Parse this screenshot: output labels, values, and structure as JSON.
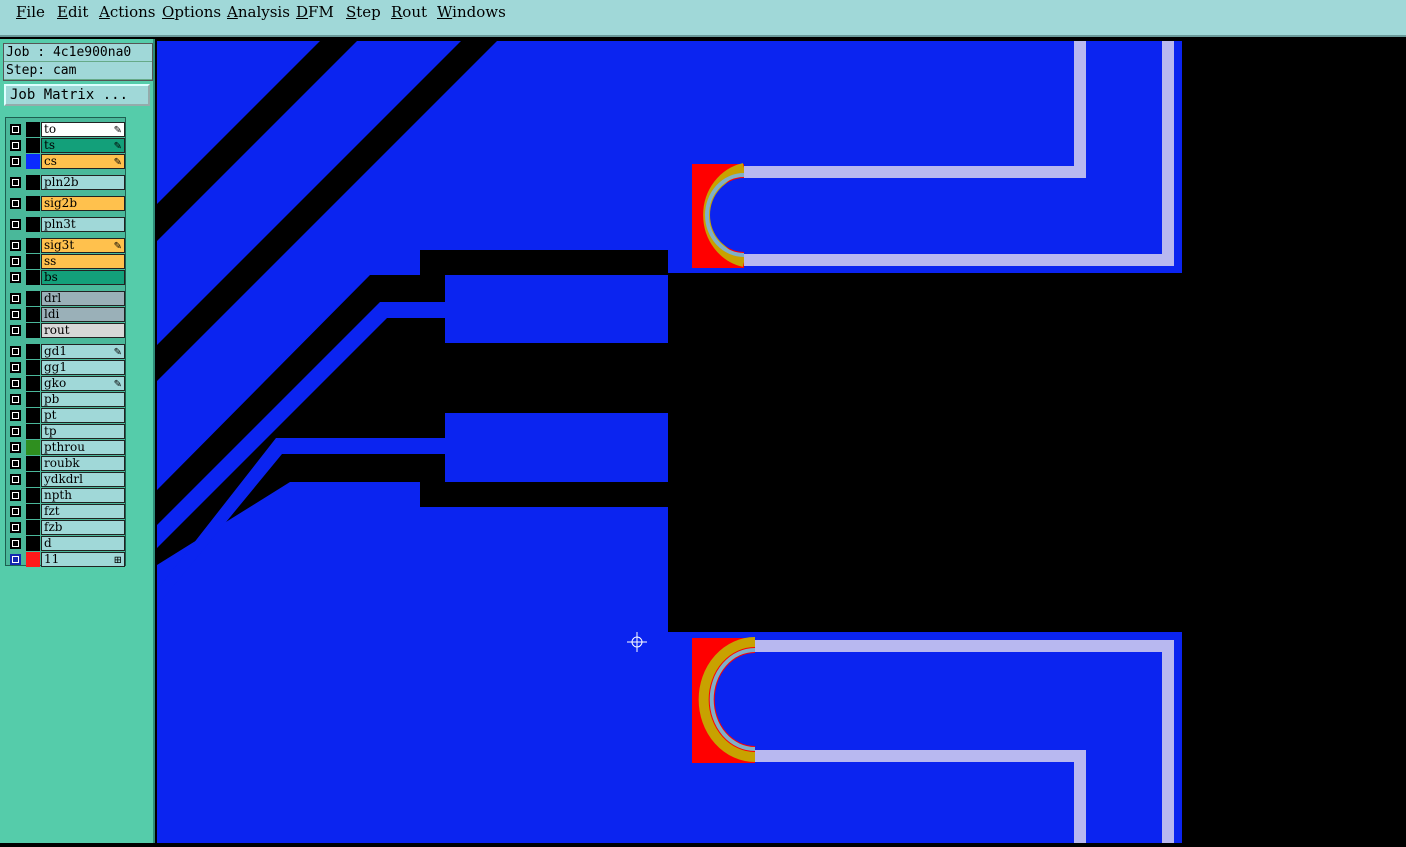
{
  "menu": [
    "File",
    "Edit",
    "Actions",
    "Options",
    "Analysis",
    "DFM",
    "Step",
    "Rout",
    "Windows"
  ],
  "job": {
    "job_line": "Job : 4c1e900na0",
    "step_line": "Step: cam",
    "matrix_button": "Job Matrix ..."
  },
  "layers": [
    {
      "name": "to",
      "color": "#ffffff",
      "swatch": "#000000",
      "mark": "✎"
    },
    {
      "name": "ts",
      "color": "#13a07a",
      "swatch": "#000000",
      "mark": "✎"
    },
    {
      "name": "cs",
      "color": "#ffc14d",
      "swatch": "#0b2bff",
      "mark": "✎"
    },
    {
      "name": "pln2b",
      "color": "#a0d8d8",
      "swatch": "#000000",
      "mark": ""
    },
    {
      "name": "sig2b",
      "color": "#ffc14d",
      "swatch": "#000000",
      "mark": ""
    },
    {
      "name": "pln3t",
      "color": "#a0d8d8",
      "swatch": "#000000",
      "mark": ""
    },
    {
      "name": "sig3t",
      "color": "#ffc14d",
      "swatch": "#000000",
      "mark": "✎"
    },
    {
      "name": "ss",
      "color": "#ffc14d",
      "swatch": "#000000",
      "mark": ""
    },
    {
      "name": "bs",
      "color": "#13a07a",
      "swatch": "#000000",
      "mark": ""
    },
    {
      "name": "drl",
      "color": "#9ab0b8",
      "swatch": "#000000",
      "mark": ""
    },
    {
      "name": "ldi",
      "color": "#9ab0b8",
      "swatch": "#000000",
      "mark": ""
    },
    {
      "name": "rout",
      "color": "#d8d8d8",
      "swatch": "#000000",
      "mark": ""
    },
    {
      "name": "gd1",
      "color": "#a0d8d8",
      "swatch": "#000000",
      "mark": "✎"
    },
    {
      "name": "gg1",
      "color": "#a0d8d8",
      "swatch": "#000000",
      "mark": ""
    },
    {
      "name": "gko",
      "color": "#a0d8d8",
      "swatch": "#000000",
      "mark": "✎"
    },
    {
      "name": "pb",
      "color": "#a0d8d8",
      "swatch": "#000000",
      "mark": ""
    },
    {
      "name": "pt",
      "color": "#a0d8d8",
      "swatch": "#000000",
      "mark": ""
    },
    {
      "name": "tp",
      "color": "#a0d8d8",
      "swatch": "#000000",
      "mark": ""
    },
    {
      "name": "pthrou",
      "color": "#a0d8d8",
      "swatch": "#2f8f1f",
      "mark": ""
    },
    {
      "name": "roubk",
      "color": "#a0d8d8",
      "swatch": "#000000",
      "mark": ""
    },
    {
      "name": "ydkdrl",
      "color": "#a0d8d8",
      "swatch": "#000000",
      "mark": ""
    },
    {
      "name": "npth",
      "color": "#a0d8d8",
      "swatch": "#000000",
      "mark": ""
    },
    {
      "name": "fzt",
      "color": "#a0d8d8",
      "swatch": "#000000",
      "mark": ""
    },
    {
      "name": "fzb",
      "color": "#a0d8d8",
      "swatch": "#000000",
      "mark": ""
    },
    {
      "name": "d",
      "color": "#a0d8d8",
      "swatch": "#000000",
      "mark": ""
    },
    {
      "name": "11",
      "color": "#a0d8d8",
      "swatch": "#ff1a1a",
      "mark": "⊞"
    }
  ],
  "colors": {
    "copper": "#0b24f0",
    "trace": "#b8b8f0",
    "pad_red": "#ff0000",
    "background": "#000000"
  }
}
